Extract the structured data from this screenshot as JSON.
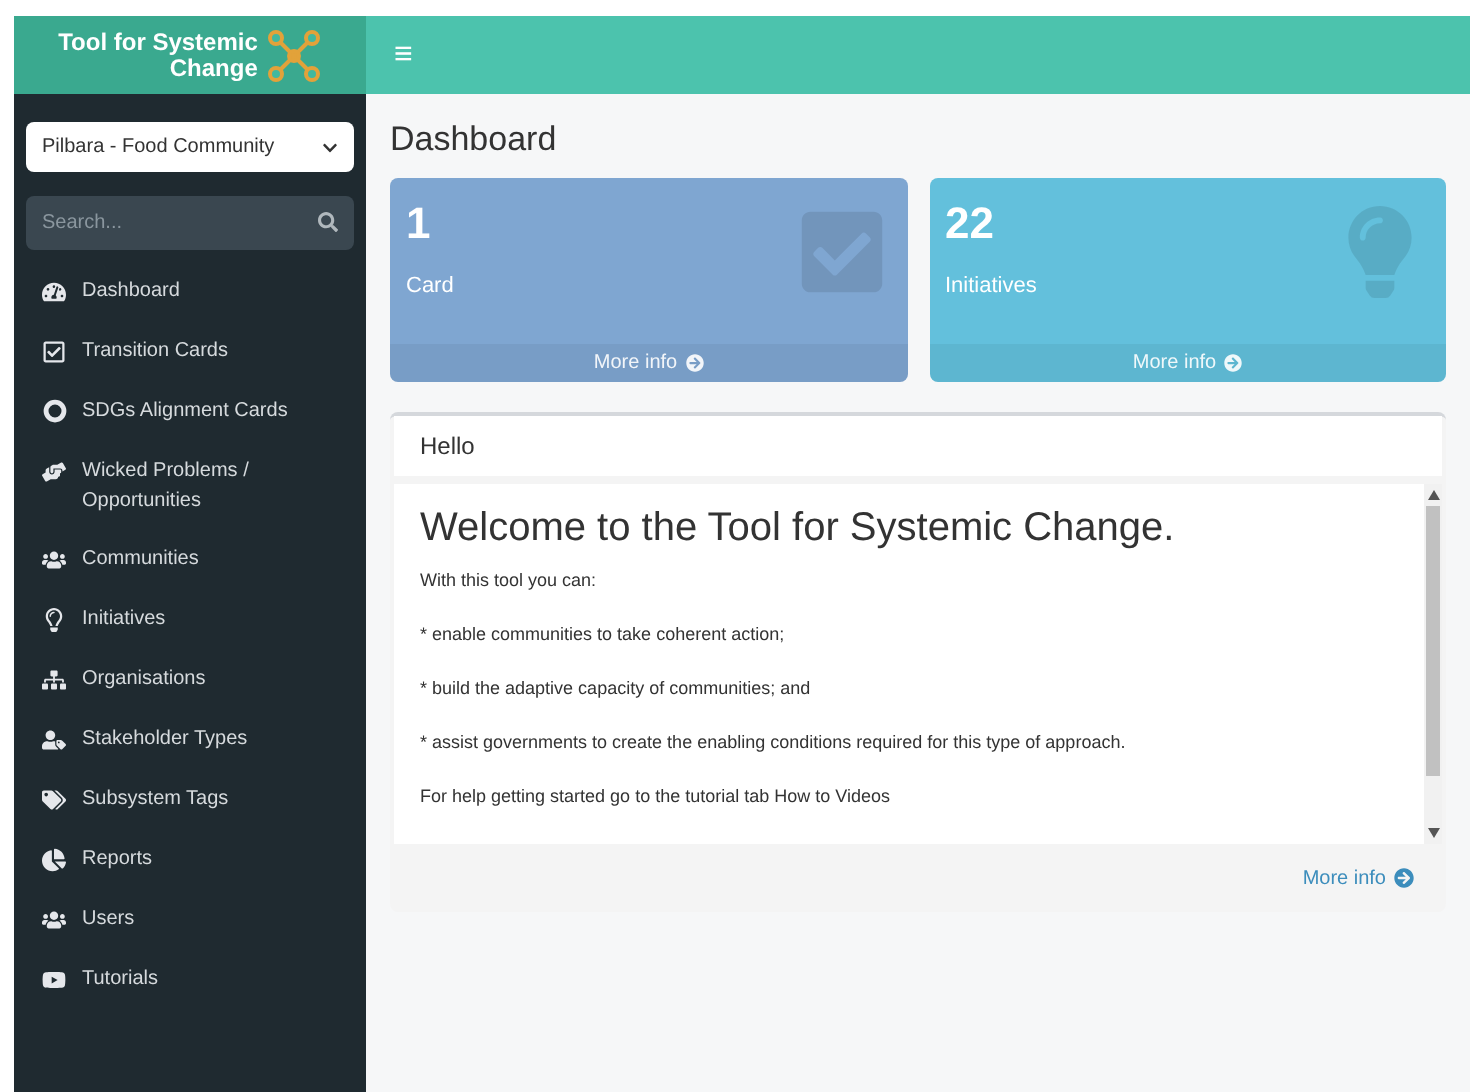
{
  "brand": {
    "line1": "Tool for Systemic",
    "line2": "Change"
  },
  "community_select": {
    "value": "Pilbara - Food Community"
  },
  "search": {
    "placeholder": "Search..."
  },
  "menu_toggle": "≡",
  "nav": [
    {
      "label": "Dashboard"
    },
    {
      "label": "Transition Cards"
    },
    {
      "label": "SDGs Alignment Cards"
    },
    {
      "label": "Wicked Problems / Opportunities"
    },
    {
      "label": "Communities"
    },
    {
      "label": "Initiatives"
    },
    {
      "label": "Organisations"
    },
    {
      "label": "Stakeholder Types"
    },
    {
      "label": "Subsystem Tags"
    },
    {
      "label": "Reports"
    },
    {
      "label": "Users"
    },
    {
      "label": "Tutorials"
    }
  ],
  "page_title": "Dashboard",
  "info_boxes": [
    {
      "count": "1",
      "label": "Card",
      "link": "More info",
      "color": "#7fa6d1"
    },
    {
      "count": "22",
      "label": "Initiatives",
      "link": "More info",
      "color": "#63c0dc"
    }
  ],
  "welcome_panel": {
    "header": "Hello",
    "heading": "Welcome to the Tool for Systemic Change.",
    "paragraphs": [
      "With this tool you can:",
      "* enable communities to take coherent action;",
      "* build the adaptive capacity of communities; and",
      "* assist governments to create the enabling conditions required for this type of approach.",
      "For help getting started go to the tutorial tab How to Videos"
    ],
    "link": "More info"
  }
}
